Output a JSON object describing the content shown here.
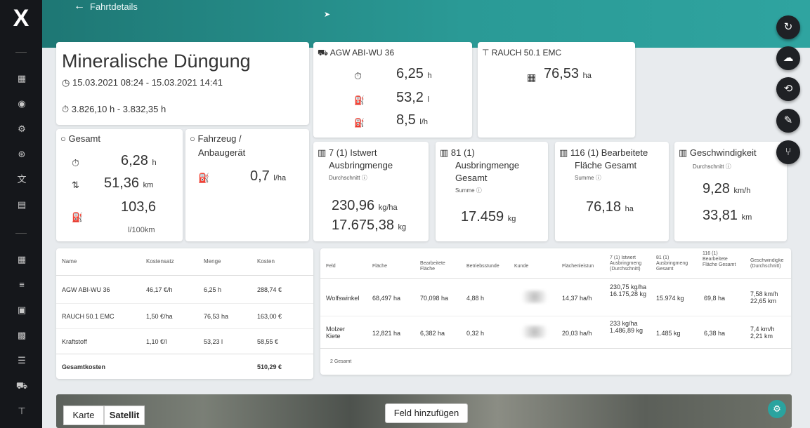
{
  "header": {
    "title": "Fahrtdetails"
  },
  "job": {
    "title": "Mineralische Düngung",
    "time_range": "15.03.2021 08:24  -  15.03.2021 14:41",
    "hours_range": "3.826,10 h - 3.832,35 h"
  },
  "vehicle": {
    "name": "AGW ABI-WU 36",
    "hours": "6,25",
    "hours_unit": "h",
    "fuel": "53,2",
    "fuel_unit": "l",
    "fuel_rate": "8,5",
    "fuel_rate_unit": "l/h"
  },
  "implement": {
    "name": "RAUCH 50.1 EMC",
    "area": "76,53",
    "area_unit": "ha"
  },
  "gesamt": {
    "title": "Gesamt",
    "hours": "6,28",
    "hours_unit": "h",
    "distance": "51,36",
    "distance_unit": "km",
    "fuel": "103,6",
    "fuel_unit": "l/100km"
  },
  "fahrzeug": {
    "title_line1": "Fahrzeug /",
    "title_line2": "Anbaugerät",
    "fuel": "0,7",
    "fuel_unit": "l/ha"
  },
  "kpi": {
    "istwert": {
      "title_line1": "7 (1) Istwert",
      "title_line2": "Ausbringmenge",
      "sub": "Durchschnitt",
      "value1": "230,96",
      "unit1": "kg/ha",
      "value2": "17.675,38",
      "unit2": "kg"
    },
    "ausbring": {
      "title_line1": "81 (1)",
      "title_line2": "Ausbringmenge",
      "title_line3": "Gesamt",
      "sub": "Summe",
      "value": "17.459",
      "unit": "kg"
    },
    "flaeche": {
      "title_line1": "116 (1) Bearbeitete",
      "title_line2": "Fläche Gesamt",
      "sub": "Summe",
      "value": "76,18",
      "unit": "ha"
    },
    "speed": {
      "title": "Geschwindigkeit",
      "sub": "Durchschnitt",
      "value1": "9,28",
      "unit1": "km/h",
      "value2": "33,81",
      "unit2": "km"
    }
  },
  "cost_table": {
    "headers": [
      "Name",
      "Kostensatz",
      "Menge",
      "Kosten"
    ],
    "rows": [
      [
        "AGW ABI-WU 36",
        "46,17 €/h",
        "6,25 h",
        "288,74 €"
      ],
      [
        "RAUCH 50.1 EMC",
        "1,50 €/ha",
        "76,53 ha",
        "163,00 €"
      ],
      [
        "Kraftstoff",
        "1,10 €/l",
        "53,23 l",
        "58,55 €"
      ]
    ],
    "total_label": "Gesamtkosten",
    "total_value": "510,29 €"
  },
  "field_table": {
    "headers": [
      "Feld",
      "Fläche",
      "Bearbeitete Fläche",
      "Betriebsstunde",
      "Kunde",
      "Flächenleistun",
      "7 (1) Istwert Ausbringmeng (Durchschnitt)",
      "81 (1) Ausbringmeng Gesamt",
      "116 (1) Bearbeitete Fläche Gesamt",
      "Geschwindigke (Durchschnitt)"
    ],
    "rows": [
      [
        "Wolfswinkel",
        "68,497 ha",
        "70,098 ha",
        "4,88 h",
        "",
        "14,37 ha/h",
        "230,75 kg/ha 16.175,28 kg",
        "15.974 kg",
        "69,8 ha",
        "7,58 km/h 22,65 km"
      ],
      [
        "Molzer Kiete",
        "12,821 ha",
        "6,382 ha",
        "0,32 h",
        "",
        "20,03 ha/h",
        "233 kg/ha 1.486,89 kg",
        "1.485 kg",
        "6,38 ha",
        "7,4 km/h 2,21 km"
      ]
    ],
    "footer": "2 Gesamt"
  },
  "map": {
    "tab_map": "Karte",
    "tab_satellite": "Satellit",
    "add_field": "Feld hinzufügen"
  }
}
